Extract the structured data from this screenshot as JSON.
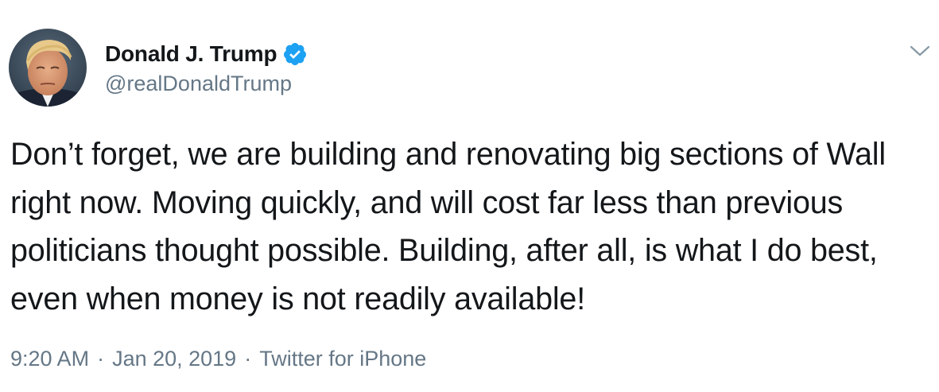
{
  "author": {
    "display_name": "Donald J. Trump",
    "handle": "@realDonaldTrump",
    "verified": true,
    "avatar_icon": "profile-photo"
  },
  "tweet": {
    "text": "Don’t forget, we are building and renovating big sections of Wall right now. Moving quickly, and will cost far less than previous politicians thought possible. Building, after all, is what I do best, even when money is not readily available!"
  },
  "meta": {
    "time": "9:20 AM",
    "separator": "·",
    "date": "Jan 20, 2019",
    "source": "Twitter for iPhone"
  },
  "icons": {
    "verified": "verified-badge-icon",
    "menu": "chevron-down-icon"
  },
  "colors": {
    "verified_blue": "#1da1f2",
    "secondary_text": "#657786",
    "primary_text": "#14171a",
    "background": "#ffffff"
  }
}
